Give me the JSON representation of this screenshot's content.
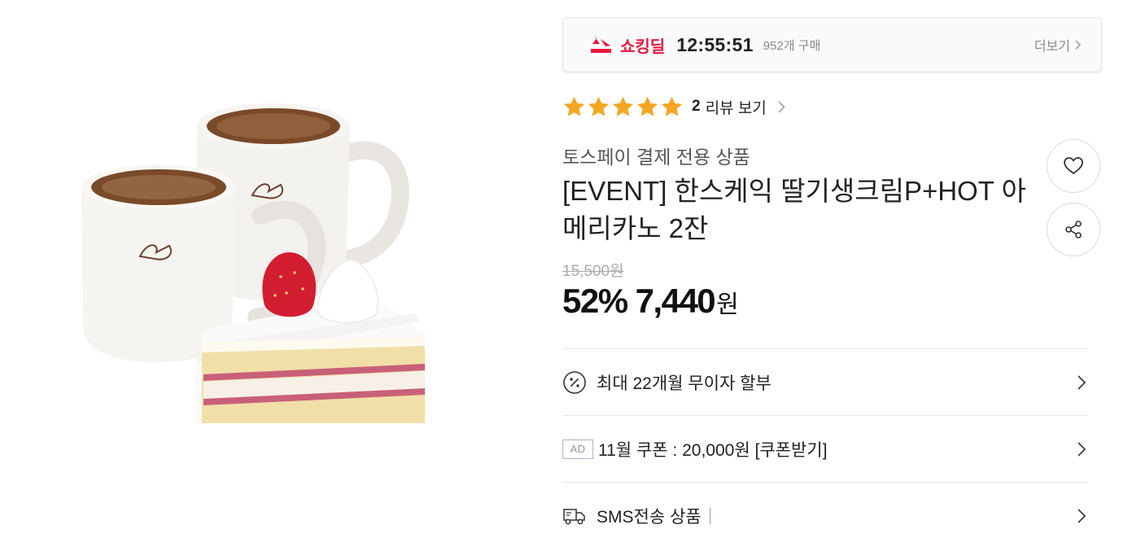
{
  "deal": {
    "label": "쇼킹딜",
    "timer": "12:55:51",
    "purchase_count": "952개 구매",
    "more_label": "더보기",
    "accent": "#e8173f"
  },
  "rating": {
    "stars": 5,
    "review_count": "2",
    "review_link": "리뷰 보기",
    "star_color": "#f5a623"
  },
  "product": {
    "seller_tag": "토스페이 결제 전용 상품",
    "title": "[EVENT] 한스케익 딸기생크림P+HOT 아메리카노 2잔",
    "image_alt": "coffee mugs and strawberry cake"
  },
  "price": {
    "original": "15,500원",
    "discount": "52%",
    "sale": "7,440",
    "currency": "원"
  },
  "actions": {
    "wish_icon": "heart-icon",
    "share_icon": "share-icon"
  },
  "rows": [
    {
      "icon": "percent-icon",
      "text": "최대 22개월 무이자 할부"
    },
    {
      "icon": "ad-badge",
      "badge": "AD",
      "text": "11월 쿠폰 : 20,000원 [쿠폰받기]"
    },
    {
      "icon": "delivery-truck-icon",
      "text": "SMS전송 상품"
    }
  ]
}
